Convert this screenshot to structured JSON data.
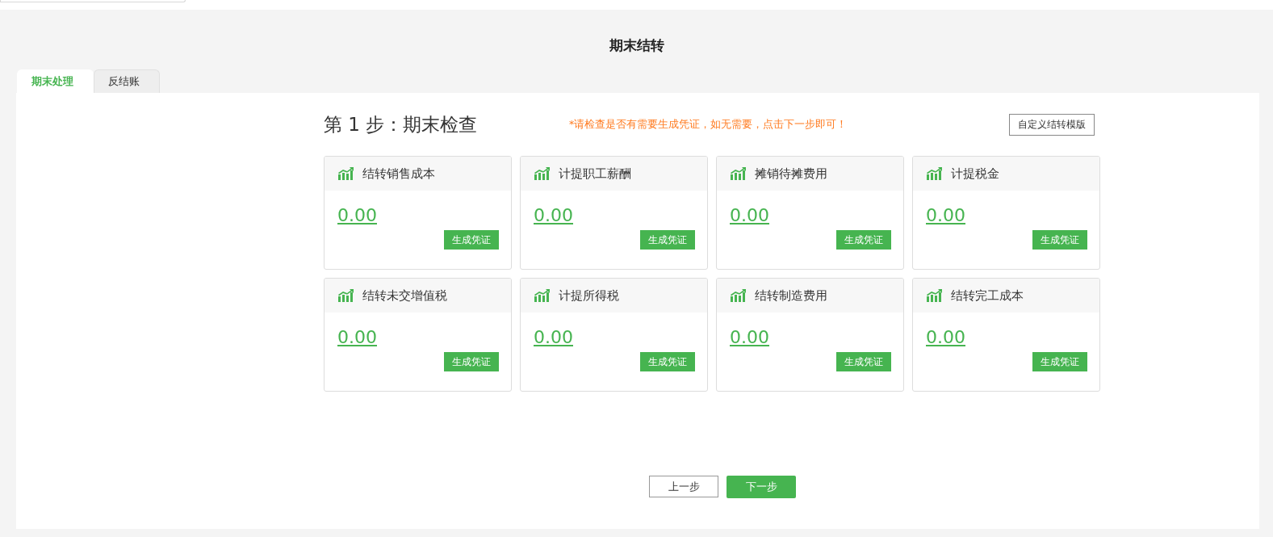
{
  "page_title": "期末结转",
  "tabs": [
    {
      "label": "期末处理",
      "selected": true
    },
    {
      "label": "反结账",
      "selected": false
    }
  ],
  "step_title": "第 1 步：期末检查",
  "hint": "*请检查是否有需要生成凭证，如无需要，点击下一步即可！",
  "custom_template_button": "自定义结转模版",
  "cards": [
    {
      "title": "结转销售成本",
      "amount": "0.00",
      "button": "生成凭证"
    },
    {
      "title": "计提职工薪酬",
      "amount": "0.00",
      "button": "生成凭证"
    },
    {
      "title": "摊销待摊费用",
      "amount": "0.00",
      "button": "生成凭证"
    },
    {
      "title": "计提税金",
      "amount": "0.00",
      "button": "生成凭证"
    },
    {
      "title": "结转未交增值税",
      "amount": "0.00",
      "button": "生成凭证"
    },
    {
      "title": "计提所得税",
      "amount": "0.00",
      "button": "生成凭证"
    },
    {
      "title": "结转制造费用",
      "amount": "0.00",
      "button": "生成凭证"
    },
    {
      "title": "结转完工成本",
      "amount": "0.00",
      "button": "生成凭证"
    }
  ],
  "prev_button": "上一步",
  "next_button": "下一步"
}
